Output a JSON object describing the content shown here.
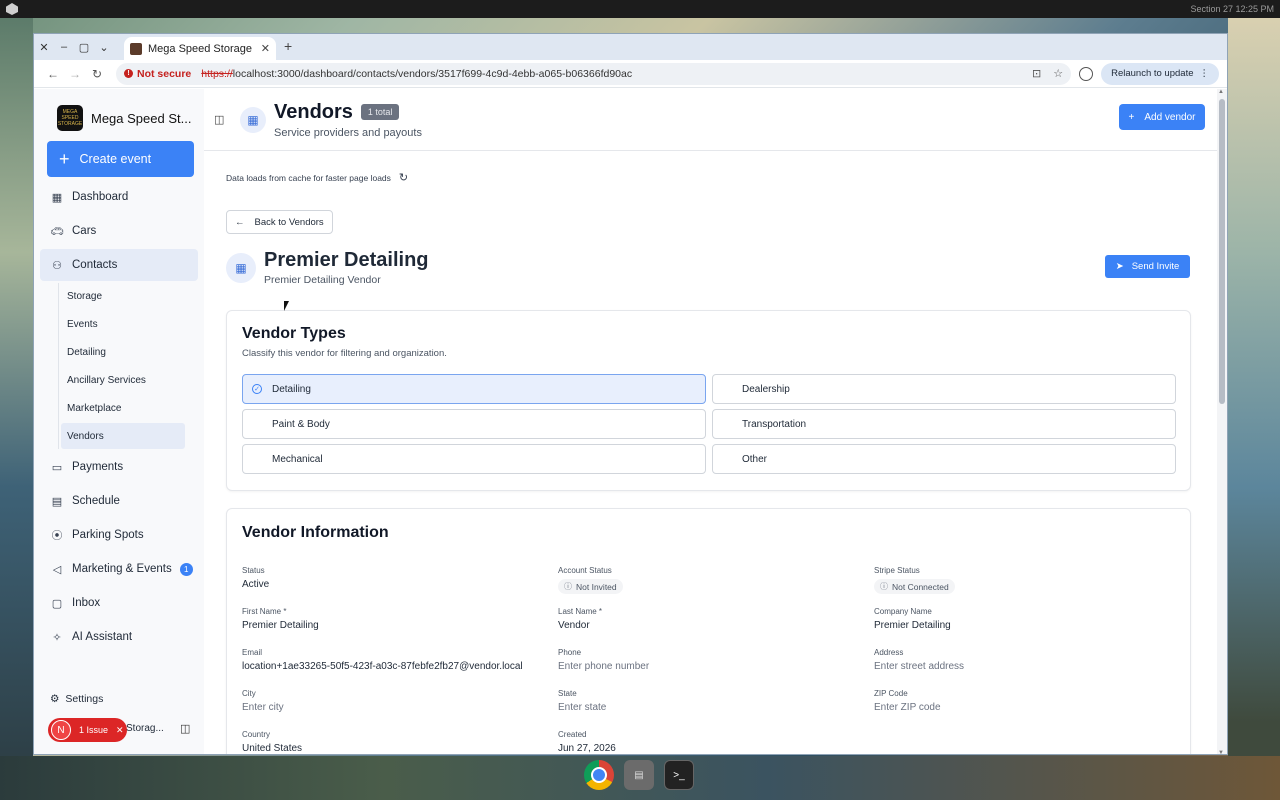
{
  "os": {
    "clock": "Section 27  12:25 PM"
  },
  "browser": {
    "tab_title": "Mega Speed Storage",
    "security_label": "Not secure",
    "url_scheme": "https://",
    "url_rest": "localhost:3000/dashboard/contacts/vendors/3517f699-4c9d-4ebb-a065-b06366fd90ac",
    "relaunch_label": "Relaunch to update"
  },
  "sidebar": {
    "brand_name": "Mega Speed St...",
    "brand_logo_text": "MEGA SPEED STORAGE",
    "create_label": "Create event",
    "items": [
      {
        "label": "Dashboard"
      },
      {
        "label": "Cars"
      },
      {
        "label": "Contacts"
      }
    ],
    "contacts_sub": [
      {
        "label": "Storage"
      },
      {
        "label": "Events"
      },
      {
        "label": "Detailing"
      },
      {
        "label": "Ancillary Services"
      },
      {
        "label": "Marketplace"
      },
      {
        "label": "Vendors"
      }
    ],
    "items_after": [
      {
        "label": "Payments"
      },
      {
        "label": "Schedule"
      },
      {
        "label": "Parking Spots"
      },
      {
        "label": "Marketing & Events",
        "badge": "1"
      },
      {
        "label": "Inbox"
      },
      {
        "label": "AI Assistant"
      }
    ],
    "settings_label": "Settings",
    "issue_initial": "N",
    "issue_label": "1 Issue",
    "footer_storage": "Storag..."
  },
  "header": {
    "title": "Vendors",
    "count": "1 total",
    "subtitle": "Service providers and payouts",
    "add_label": "Add vendor"
  },
  "main": {
    "cache_note": "Data loads from cache for faster page loads",
    "back_label": "Back to Vendors",
    "vendor_name": "Premier Detailing",
    "vendor_sub": "Premier Detailing Vendor",
    "send_invite_label": "Send Invite"
  },
  "vendor_types": {
    "title": "Vendor Types",
    "description": "Classify this vendor for filtering and organization.",
    "options": [
      {
        "label": "Detailing",
        "selected": true
      },
      {
        "label": "Dealership",
        "selected": false
      },
      {
        "label": "Paint & Body",
        "selected": false
      },
      {
        "label": "Transportation",
        "selected": false
      },
      {
        "label": "Mechanical",
        "selected": false
      },
      {
        "label": "Other",
        "selected": false
      }
    ]
  },
  "vendor_info": {
    "title": "Vendor Information",
    "status_label": "Status",
    "status_value": "Active",
    "account_status_label": "Account Status",
    "account_status_value": "Not Invited",
    "stripe_status_label": "Stripe Status",
    "stripe_status_value": "Not Connected",
    "first_name_label": "First Name *",
    "first_name_value": "Premier Detailing",
    "last_name_label": "Last Name *",
    "last_name_value": "Vendor",
    "company_label": "Company Name",
    "company_value": "Premier Detailing",
    "email_label": "Email",
    "email_value": "location+1ae33265-50f5-423f-a03c-87febfe2fb27@vendor.local",
    "phone_label": "Phone",
    "phone_placeholder": "Enter phone number",
    "address_label": "Address",
    "address_placeholder": "Enter street address",
    "city_label": "City",
    "city_placeholder": "Enter city",
    "state_label": "State",
    "state_placeholder": "Enter state",
    "zip_label": "ZIP Code",
    "zip_placeholder": "Enter ZIP code",
    "country_label": "Country",
    "country_value": "United States",
    "created_label": "Created",
    "created_value": "Jun 27, 2026"
  },
  "colors": {
    "accent": "#3b82f6",
    "danger": "#dc2626"
  }
}
